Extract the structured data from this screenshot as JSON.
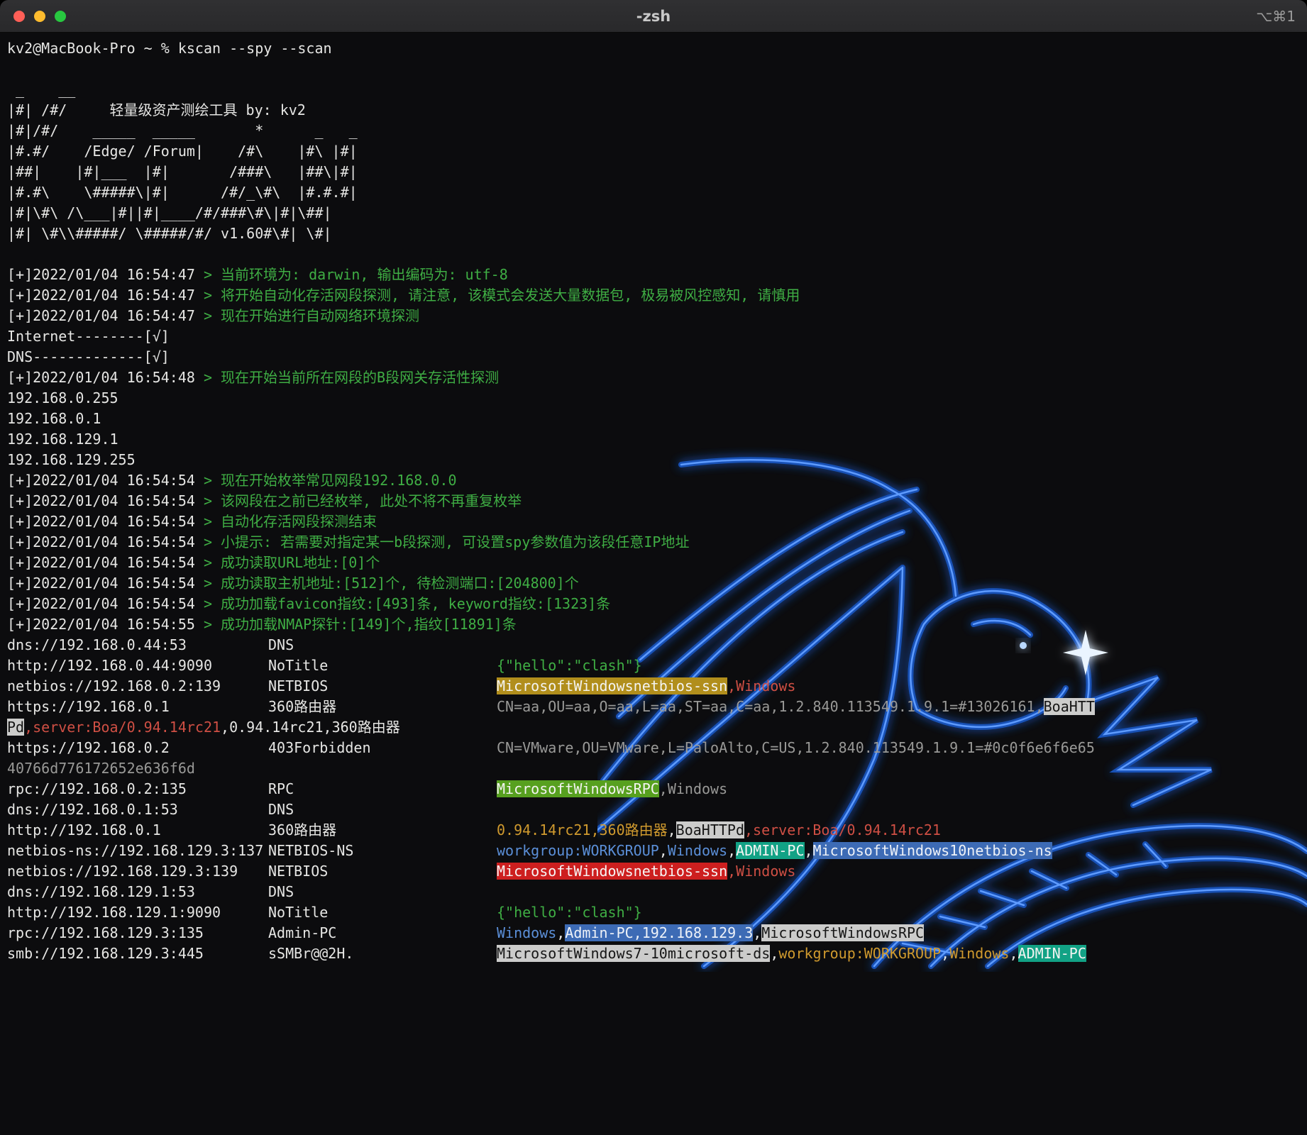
{
  "window": {
    "title": "-zsh",
    "shortcut": "⌥⌘1"
  },
  "colors": {
    "bg": "#0c0c0e",
    "white": "#e6e6e4",
    "green": "#3fae44",
    "gray": "#999997",
    "red": "#cf4f44",
    "orange": "#d09a2e",
    "blue": "#5b8fd8",
    "hl_yellow": "#b18e1c",
    "hl_gray": "#cccccb",
    "hl_green": "#57a01f",
    "hl_teal": "#12a285",
    "hl_blue": "#3d6bb5",
    "hl_red": "#cd1f1f",
    "dragon": "#1b63e0"
  },
  "terminal": {
    "prompt": "kv2@MacBook-Pro ~ % kscan --spy --scan",
    "lines": [
      {
        "c1": [
          [
            "white",
            "kv2@MacBook-Pro ~ % kscan --spy --scan"
          ]
        ]
      },
      {
        "c1": []
      },
      {
        "c1": [
          [
            "white",
            " _    __"
          ]
        ]
      },
      {
        "c1": [
          [
            "white",
            "|#| /#/     轻量级资产测绘工具 by: kv2"
          ]
        ]
      },
      {
        "c1": [
          [
            "white",
            "|#|/#/    _____  _____       *      _   _"
          ]
        ]
      },
      {
        "c1": [
          [
            "white",
            "|#.#/    /Edge/ /Forum|    /#\\    |#\\ |#|"
          ]
        ]
      },
      {
        "c1": [
          [
            "white",
            "|##|    |#|___  |#|       /###\\   |##\\|#|"
          ]
        ]
      },
      {
        "c1": [
          [
            "white",
            "|#.#\\    \\#####\\|#|      /#/_\\#\\  |#.#.#|"
          ]
        ]
      },
      {
        "c1": [
          [
            "white",
            "|#|\\#\\ /\\___|#||#|____/#/###\\#\\|#|\\##|"
          ]
        ]
      },
      {
        "c1": [
          [
            "white",
            "|#| \\#\\\\#####/ \\#####/#/ v1.60#\\#| \\#|"
          ]
        ]
      },
      {
        "c1": []
      },
      {
        "c1": [
          [
            "white",
            "[+]2022/01/04 16:54:47 "
          ],
          [
            "green",
            "> 当前环境为: darwin, 输出编码为: utf-8"
          ]
        ]
      },
      {
        "c1": [
          [
            "white",
            "[+]2022/01/04 16:54:47 "
          ],
          [
            "green",
            "> 将开始自动化存活网段探测, 请注意, 该模式会发送大量数据包, 极易被风控感知, 请慎用"
          ]
        ]
      },
      {
        "c1": [
          [
            "white",
            "[+]2022/01/04 16:54:47 "
          ],
          [
            "green",
            "> 现在开始进行自动网络环境探测"
          ]
        ]
      },
      {
        "c1": [
          [
            "white",
            "Internet--------[√]"
          ]
        ]
      },
      {
        "c1": [
          [
            "white",
            "DNS-------------[√]"
          ]
        ]
      },
      {
        "c1": [
          [
            "white",
            "[+]2022/01/04 16:54:48 "
          ],
          [
            "green",
            "> 现在开始当前所在网段的B段网关存活性探测"
          ]
        ]
      },
      {
        "c1": [
          [
            "white",
            "192.168.0.255"
          ]
        ]
      },
      {
        "c1": [
          [
            "white",
            "192.168.0.1"
          ]
        ]
      },
      {
        "c1": [
          [
            "white",
            "192.168.129.1"
          ]
        ]
      },
      {
        "c1": [
          [
            "white",
            "192.168.129.255"
          ]
        ]
      },
      {
        "c1": [
          [
            "white",
            "[+]2022/01/04 16:54:54 "
          ],
          [
            "green",
            "> 现在开始枚举常见网段192.168.0.0"
          ]
        ]
      },
      {
        "c1": [
          [
            "white",
            "[+]2022/01/04 16:54:54 "
          ],
          [
            "green",
            "> 该网段在之前已经枚举, 此处不将不再重复枚举"
          ]
        ]
      },
      {
        "c1": [
          [
            "white",
            "[+]2022/01/04 16:54:54 "
          ],
          [
            "green",
            "> 自动化存活网段探测结束"
          ]
        ]
      },
      {
        "c1": [
          [
            "white",
            "[+]2022/01/04 16:54:54 "
          ],
          [
            "green",
            "> 小提示: 若需要对指定某一b段探测, 可设置spy参数值为该段任意IP地址"
          ]
        ]
      },
      {
        "c1": [
          [
            "white",
            "[+]2022/01/04 16:54:54 "
          ],
          [
            "green",
            "> 成功读取URL地址:[0]个"
          ]
        ]
      },
      {
        "c1": [
          [
            "white",
            "[+]2022/01/04 16:54:54 "
          ],
          [
            "green",
            "> 成功读取主机地址:[512]个, 待检测端口:[204800]个"
          ]
        ]
      },
      {
        "c1": [
          [
            "white",
            "[+]2022/01/04 16:54:54 "
          ],
          [
            "green",
            "> 成功加载favicon指纹:[493]条, keyword指纹:[1323]条"
          ]
        ]
      },
      {
        "c1": [
          [
            "white",
            "[+]2022/01/04 16:54:55 "
          ],
          [
            "green",
            "> 成功加载NMAP探针:[149]个,指纹[11891]条"
          ]
        ]
      },
      {
        "c1": [
          [
            "white",
            "dns://192.168.0.44:53"
          ]
        ],
        "c2": [
          [
            "white",
            "DNS"
          ]
        ]
      },
      {
        "c1": [
          [
            "white",
            "http://192.168.0.44:9090"
          ]
        ],
        "c2": [
          [
            "white",
            "NoTitle"
          ]
        ],
        "c3": [
          [
            "green",
            "{\"hello\":\"clash\"}"
          ]
        ]
      },
      {
        "c1": [
          [
            "white",
            "netbios://192.168.0.2:139"
          ]
        ],
        "c2": [
          [
            "white",
            "NETBIOS"
          ]
        ],
        "c3": [
          [
            "hl-yellow",
            "MicrosoftWindowsnetbios-ssn"
          ],
          [
            "red",
            ",Windows"
          ]
        ]
      },
      {
        "c1": [
          [
            "white",
            "https://192.168.0.1"
          ]
        ],
        "c2": [
          [
            "white",
            "360路由器"
          ]
        ],
        "c3": [
          [
            "gray",
            "CN=aa,OU=aa,O=aa,L=aa,ST=aa,C=aa,1.2.840.113549.1.9.1=#13026161,"
          ],
          [
            "hl-gray",
            "BoaHTT"
          ]
        ]
      },
      {
        "c1": [
          [
            "hl-gray",
            "Pd"
          ],
          [
            "red",
            ",server:Boa/0.94.14rc21"
          ],
          [
            "white",
            ",0.94.14rc21,360路由器"
          ]
        ]
      },
      {
        "c1": [
          [
            "white",
            "https://192.168.0.2"
          ]
        ],
        "c2": [
          [
            "white",
            "403Forbidden"
          ]
        ],
        "c3": [
          [
            "gray",
            "CN=VMware,OU=VMware,L=PaloAlto,C=US,1.2.840.113549.1.9.1=#0c0f6e6f6e65"
          ]
        ]
      },
      {
        "c1": [
          [
            "gray",
            "40766d776172652e636f6d"
          ]
        ]
      },
      {
        "c1": [
          [
            "white",
            "rpc://192.168.0.2:135"
          ]
        ],
        "c2": [
          [
            "white",
            "RPC"
          ]
        ],
        "c3": [
          [
            "hl-green",
            "MicrosoftWindowsRPC"
          ],
          [
            "gray",
            ",Windows"
          ]
        ]
      },
      {
        "c1": [
          [
            "white",
            "dns://192.168.0.1:53"
          ]
        ],
        "c2": [
          [
            "white",
            "DNS"
          ]
        ]
      },
      {
        "c1": [
          [
            "white",
            "http://192.168.0.1"
          ]
        ],
        "c2": [
          [
            "white",
            "360路由器"
          ]
        ],
        "c3": [
          [
            "orange",
            "0.94.14rc21,360路由器"
          ],
          [
            "white",
            ","
          ],
          [
            "hl-gray",
            "BoaHTTPd"
          ],
          [
            "red",
            ",server:Boa/0.94.14rc21"
          ]
        ]
      },
      {
        "c1": [
          [
            "white",
            "netbios-ns://192.168.129.3:137"
          ]
        ],
        "c2": [
          [
            "white",
            "NETBIOS-NS"
          ]
        ],
        "c3": [
          [
            "blue",
            "workgroup:WORKGROUP"
          ],
          [
            "white",
            ","
          ],
          [
            "blue",
            "Windows"
          ],
          [
            "white",
            ","
          ],
          [
            "hl-teal",
            "ADMIN-PC"
          ],
          [
            "white",
            ","
          ],
          [
            "hl-blue",
            "MicrosoftWindows10netbios-ns"
          ]
        ]
      },
      {
        "c1": [
          [
            "white",
            "netbios://192.168.129.3:139"
          ]
        ],
        "c2": [
          [
            "white",
            "NETBIOS"
          ]
        ],
        "c3": [
          [
            "hl-red",
            "MicrosoftWindowsnetbios-ssn"
          ],
          [
            "red",
            ",Windows"
          ]
        ]
      },
      {
        "c1": [
          [
            "white",
            "dns://192.168.129.1:53"
          ]
        ],
        "c2": [
          [
            "white",
            "DNS"
          ]
        ]
      },
      {
        "c1": [
          [
            "white",
            "http://192.168.129.1:9090"
          ]
        ],
        "c2": [
          [
            "white",
            "NoTitle"
          ]
        ],
        "c3": [
          [
            "green",
            "{\"hello\":\"clash\"}"
          ]
        ]
      },
      {
        "c1": [
          [
            "white",
            "rpc://192.168.129.3:135"
          ]
        ],
        "c2": [
          [
            "white",
            "Admin-PC"
          ]
        ],
        "c3": [
          [
            "blue",
            "Windows"
          ],
          [
            "white",
            ","
          ],
          [
            "hl-blue",
            "Admin-PC,192.168.129.3"
          ],
          [
            "white",
            ","
          ],
          [
            "hl-gray",
            "MicrosoftWindowsRPC"
          ]
        ]
      },
      {
        "c1": [
          [
            "white",
            "smb://192.168.129.3:445"
          ]
        ],
        "c2": [
          [
            "white",
            "sSMBr@@2H."
          ]
        ],
        "c3": [
          [
            "hl-gray",
            "MicrosoftWindows7-10microsoft-ds"
          ],
          [
            "white",
            ","
          ],
          [
            "orange",
            "workgroup:WORKGROUP"
          ],
          [
            "white",
            ","
          ],
          [
            "orange",
            "Windows"
          ],
          [
            "white",
            ","
          ],
          [
            "hl-teal",
            "ADMIN-PC"
          ]
        ]
      }
    ]
  }
}
